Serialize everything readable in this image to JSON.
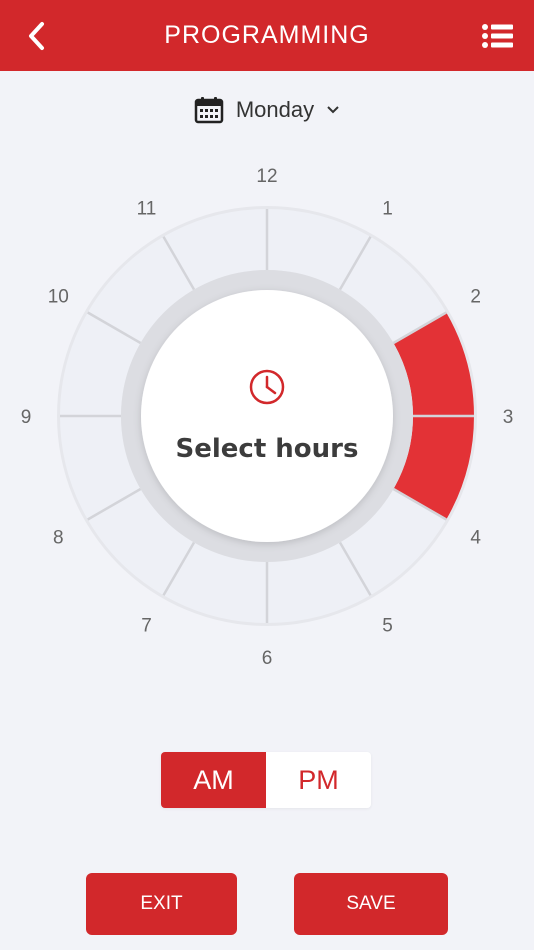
{
  "header": {
    "title": "PROGRAMMING",
    "back_icon": "chevron-left-icon",
    "menu_icon": "list-icon"
  },
  "day_selector": {
    "icon": "calendar-icon",
    "value": "Monday",
    "dropdown_icon": "chevron-down-icon"
  },
  "dial": {
    "hour_labels": [
      "12",
      "1",
      "2",
      "3",
      "4",
      "5",
      "6",
      "7",
      "8",
      "9",
      "10",
      "11"
    ],
    "selected_hours": [
      2,
      3
    ],
    "center_icon": "clock-icon",
    "center_text": "Select hours"
  },
  "period_toggle": {
    "options": [
      "AM",
      "PM"
    ],
    "selected": "AM"
  },
  "actions": {
    "exit_label": "EXIT",
    "save_label": "SAVE"
  },
  "colors": {
    "accent": "#d2282b",
    "selected_segment": "#e33236",
    "segment_fill": "#eef0f6",
    "background": "#f2f3f8"
  }
}
